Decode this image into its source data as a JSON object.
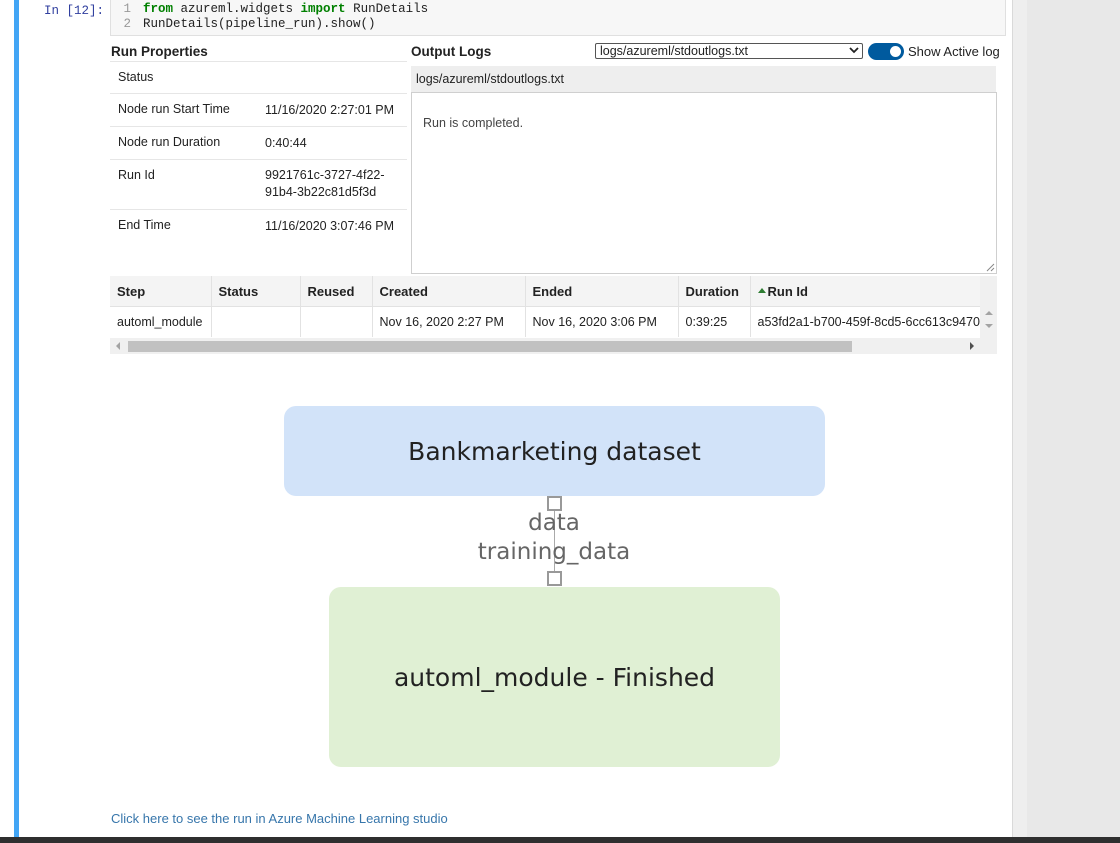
{
  "cell": {
    "prompt": "In [12]:",
    "code_lines": [
      {
        "num": "1",
        "kw1": "from",
        "mid": " azureml.widgets ",
        "kw2": "import",
        "rest": " RunDetails"
      },
      {
        "num": "2",
        "text": "RunDetails(pipeline_run).show()"
      }
    ]
  },
  "run_properties": {
    "title": "Run Properties",
    "rows": [
      {
        "key": "Status",
        "value": ""
      },
      {
        "key": "Node run Start Time",
        "value": "11/16/2020 2:27:01 PM"
      },
      {
        "key": "Node run Duration",
        "value": "0:40:44"
      },
      {
        "key": "Run Id",
        "value_line1": "9921761c-3727-4f22-",
        "value_line2": "91b4-3b22c81d5f3d"
      },
      {
        "key": "End Time",
        "value": "11/16/2020 3:07:46 PM"
      }
    ]
  },
  "output_logs": {
    "title": "Output Logs",
    "selected_log": "logs/azureml/stdoutlogs.txt",
    "toggle_label": "Show Active log",
    "toggle_on": true,
    "header": "logs/azureml/stdoutlogs.txt",
    "content": "Run is completed."
  },
  "steps_table": {
    "columns": [
      "Step",
      "Status",
      "Reused",
      "Created",
      "Ended",
      "Duration",
      "Run Id"
    ],
    "rows": [
      [
        "automl_module",
        "",
        "",
        "Nov 16, 2020 2:27 PM",
        "Nov 16, 2020 3:06 PM",
        "0:39:25",
        "a53fd2a1-b700-459f-8cd5-6cc613c9470"
      ]
    ]
  },
  "graph": {
    "source_node": "Bankmarketing dataset",
    "edge_label_1": "data",
    "edge_label_2": "training_data",
    "target_node": "automl_module - Finished",
    "colors": {
      "source": "#d2e3f9",
      "target": "#e0f0d4"
    }
  },
  "studio_link": "Click here to see the run in Azure Machine Learning studio"
}
